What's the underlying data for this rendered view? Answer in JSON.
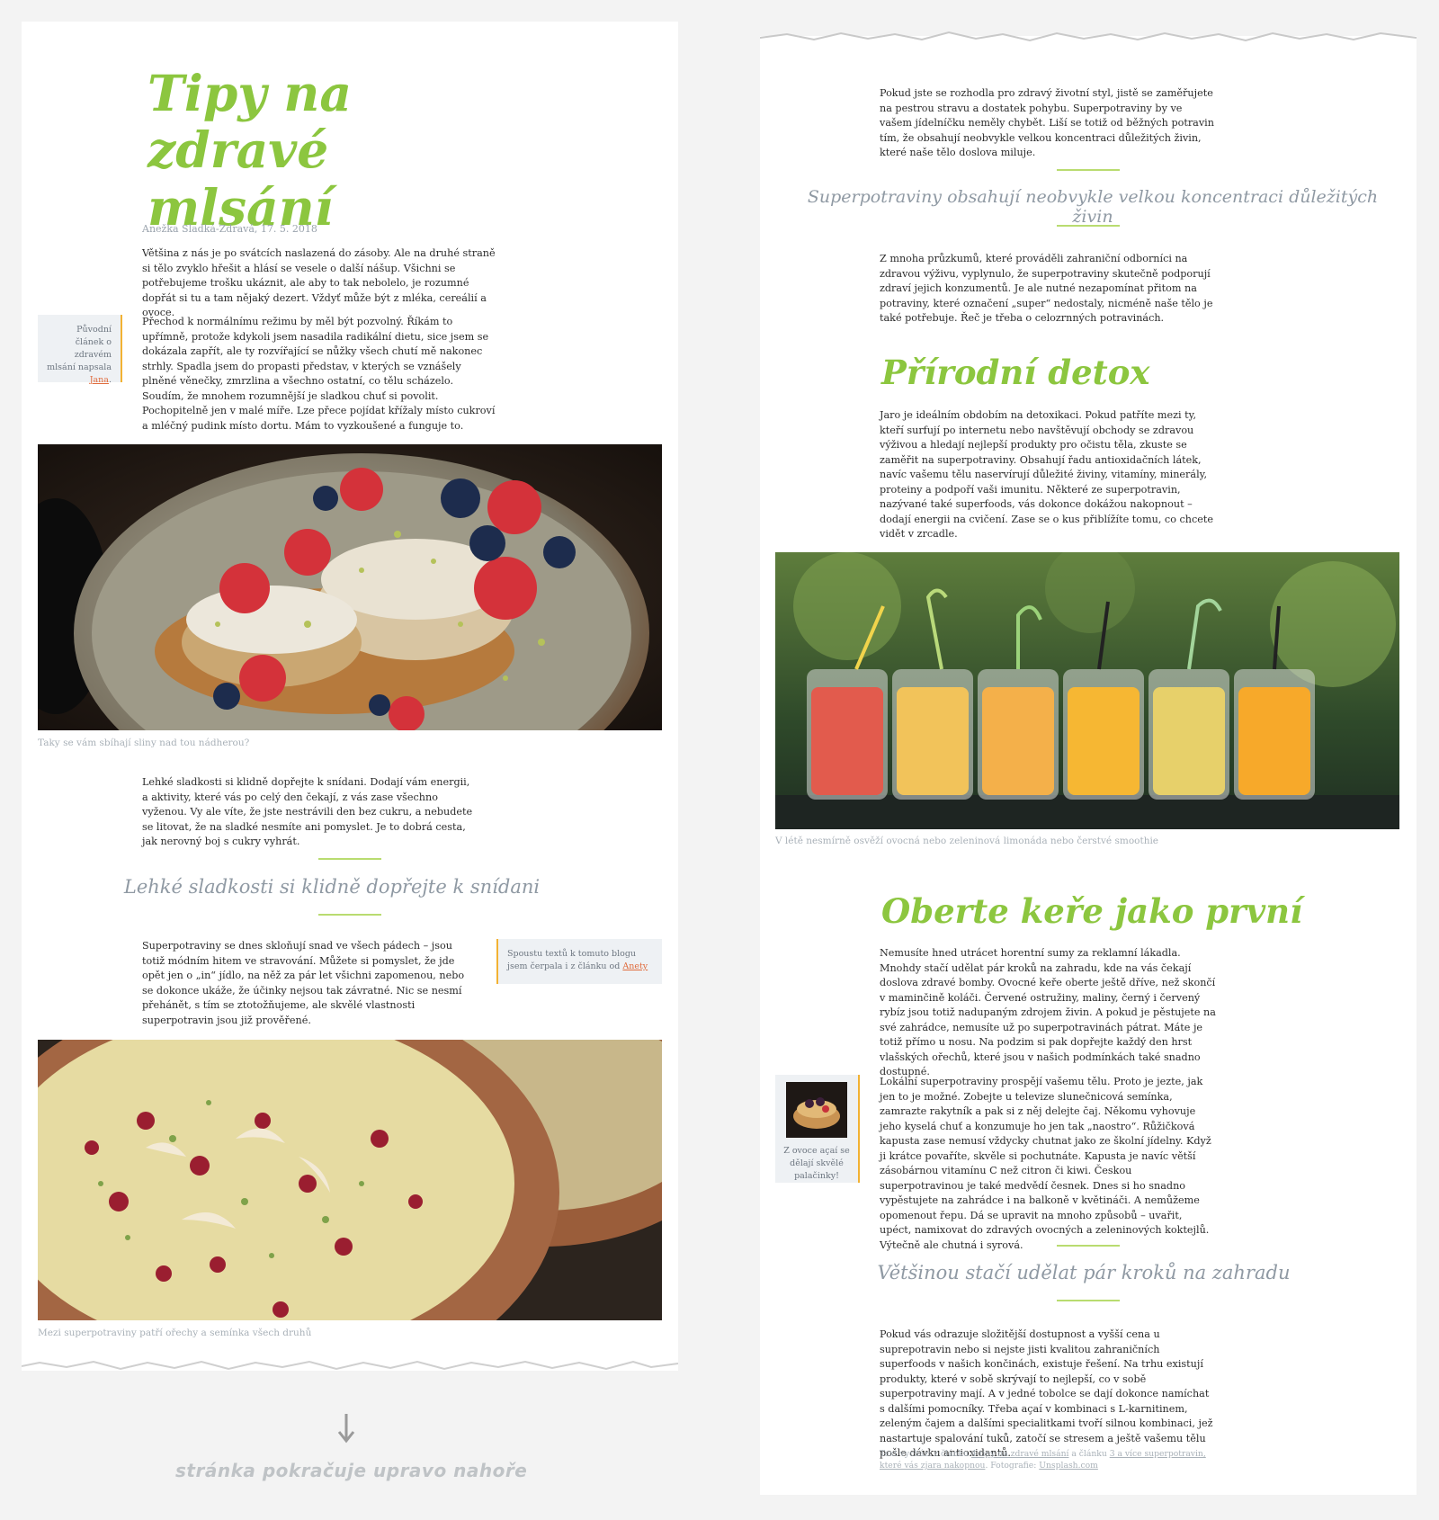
{
  "left": {
    "title": "Tipy na zdravé mlsání",
    "meta": "Anežka Sladká-Zdravá, 17. 5. 2018",
    "intro": "Většina z nás je po svátcích naslazená do zásoby. Ale na druhé straně si tělo zvyklo hřešit a hlásí se vesele o další nášup. Všichni se potřebujeme trošku ukáznit, ale aby to tak nebolelo, je rozumné dopřát si tu a tam nějaký dezert. Vždyť může být z mléka, cereálií a ovoce.",
    "aside1": {
      "text": "Původní článek o zdravém mlsání napsala",
      "link": "Jana",
      "end": "."
    },
    "para2": "Přechod k normálnímu režimu by měl být pozvolný. Říkám to upřímně, protože kdykoli jsem nasadila radikální dietu, sice jsem se dokázala zapřít, ale ty rozvířající se nůžky všech chutí mě nakonec strhly. Spadla jsem do propasti představ, v kterých se vznášely plněné věnečky, zmrzlina a všechno ostatní, co tělu scházelo. Soudím, že mnohem rozumnější je sladkou chuť si povolit. Pochopitelně jen v malé míře. Lze přece pojídat křížaly místo cukroví a mléčný pudink místo dortu. Mám to vyzkoušené a funguje to.",
    "caption1": "Taky se vám sbíhají sliny nad tou nádherou?",
    "para3": "Lehké sladkosti si klidně dopřejte k snídani. Dodají vám energii, a aktivity, které vás po celý den čekají, z vás zase všechno vyženou. Vy ale víte, že jste nestrávili den bez cukru, a nebudete se litovat, že na sladké nesmíte ani pomyslet. Je to dobrá cesta, jak nerovný boj s cukry vyhrát.",
    "pull1": "Lehké sladkosti si klidně dopřejte k snídani",
    "para4": "Superpotraviny se dnes skloňují snad ve všech pádech – jsou totiž módním hitem ve stravování. Můžete si pomyslet, že jde opět jen o „in“ jídlo, na něž za pár let všichni zapomenou, nebo se dokonce ukáže, že účinky nejsou tak závratné. Nic se nesmí přehánět, s tím se ztotožňujeme, ale skvělé vlastnosti superpotravin jsou již prověřené.",
    "aside2": {
      "text": "Spoustu textů k tomuto blogu jsem čerpala i z článku od",
      "link": "Anety"
    },
    "caption2": "Mezi superpotraviny patří ořechy a semínka všech druhů",
    "continue": "stránka pokračuje upravo nahoře"
  },
  "right": {
    "para1": "Pokud jste se rozhodla pro zdravý životní styl, jistě se zaměřujete na pestrou stravu a dostatek pohybu. Superpotraviny by ve vašem jídelníčku neměly chybět. Liší se totiž od běžných potravin tím, že obsahují neobvykle velkou koncentraci důležitých živin, které naše tělo doslova miluje.",
    "pull1": "Superpotraviny obsahují neobvykle velkou koncentraci důležitých živin",
    "para2": "Z mnoha průzkumů, které prováděli zahraniční odborníci na zdravou výživu, vyplynulo, že superpotraviny skutečně podporují zdraví jejich konzumentů. Je ale nutné nezapomínat přitom na potraviny, které označení „super“ nedostaly, nicméně naše tělo je také potřebuje. Řeč je třeba o celozrnných potravinách.",
    "h2a": "Přírodní detox",
    "para3": "Jaro je ideálním obdobím na detoxikaci. Pokud patříte mezi ty, kteří surfují po internetu nebo navštěvují obchody se zdravou výživou a hledají nejlepší produkty pro očistu těla, zkuste se zaměřit na superpotraviny. Obsahují řadu antioxidačních látek, navíc vašemu tělu naservírují důležité živiny, vitamíny, minerály, proteiny a podpoří vaši imunitu. Některé ze superpotravin, nazývané také superfoods, vás dokonce dokážou nakopnout – dodají energii na cvičení. Zase se o kus přiblížíte tomu, co chcete vidět v zrcadle.",
    "caption1": "V létě nesmírně osvěží ovocná nebo zeleninová limonáda nebo čerstvé smoothie",
    "h2b": "Oberte keře jako první",
    "para4": "Nemusíte hned utrácet horentní sumy za reklamní lákadla. Mnohdy stačí udělat pár kroků na zahradu, kde na vás čekají doslova zdravé bomby. Ovocné keře oberte ještě dříve, než skončí v maminčině koláči. Červené ostružiny, maliny, černý i červený rybíz jsou totiž nadupaným zdrojem živin. A pokud je pěstujete na své zahrádce, nemusíte už po superpotravinách pátrat. Máte je totiž přímo u nosu. Na podzim si pak dopřejte každý den hrst vlašských ořechů, které jsou v našich podmínkách také snadno dostupné.",
    "aside": {
      "text": "Z ovoce açaí se dělají skvělé palačinky!"
    },
    "para5": "Lokální superpotraviny prospějí vašemu tělu. Proto je jezte, jak jen to je možné. Zobejte u televize slunečnicová semínka, zamrazte rakytník a pak si z něj delejte čaj. Někomu vyhovuje jeho kyselá chuť a konzumuje ho jen tak „naostro“. Růžičková kapusta zase nemusí vždycky chutnat jako ze školní jídelny. Když ji krátce povaříte, skvěle si pochutnáte. Kapusta je navíc větší zásobárnou vitamínu C než citron či kiwi. Českou superpotravinou je také medvědí česnek. Dnes si ho snadno vypěstujete na zahrádce i na balkoně v květináči. A nemůžeme opomenout řepu. Dá se upravit na mnoho způsobů – uvařit, upéct, namixovat do zdravých ovocných a zeleninových koktejlů. Výtečně ale chutná i syrová.",
    "pull2": "Většinou stačí udělat pár kroků na zahradu",
    "para6": "Pokud vás odrazuje složitější dostupnost a vyšší cena u suprepotravin nebo si nejste jisti kvalitou zahraničních superfoods v našich končinách, existuje řešení. Na trhu existují produkty, které v sobě skrývají to nejlepší, co v sobě superpotraviny mají. A v jedné tobolce se dají dokonce namíchat s dalšími pomocníky. Třeba açaí v kombinaci s L-karnitinem, zeleným čajem a dalšími specialitkami tvoří silnou kombinaci, jež nastartuje spalování tuků, zatočí se stresem a ještě vašemu tělu pošle dávku antioxidantů.",
    "foot": {
      "a": "Text vychází z článku",
      "link1": "4 tipy na zdravé mlsání",
      "b": "a článku",
      "link2": "3 a více superpotravin, které vás zjara nakopnou",
      "c": ". Fotografie:",
      "link3": "Unsplash.com"
    }
  }
}
